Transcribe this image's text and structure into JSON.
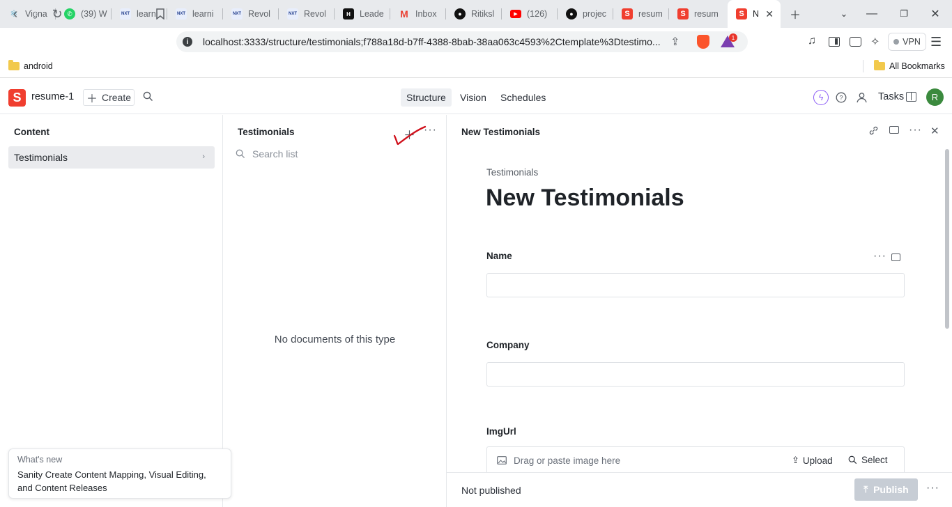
{
  "browser": {
    "tabs": [
      {
        "label": "Vigna",
        "icon": "react-icon",
        "color": "#61dafb"
      },
      {
        "label": "(39) W",
        "icon": "whatsapp-icon",
        "color": "#25d366"
      },
      {
        "label": "learni",
        "icon": "nxtwave-icon",
        "color": "#1e3a8a"
      },
      {
        "label": "learni",
        "icon": "nxtwave-icon",
        "color": "#1e3a8a"
      },
      {
        "label": "Revol",
        "icon": "nxtwave-icon",
        "color": "#1e3a8a"
      },
      {
        "label": "Revol",
        "icon": "nxtwave-icon",
        "color": "#1e3a8a"
      },
      {
        "label": "Leade",
        "icon": "hackerrank-icon",
        "color": "#111111"
      },
      {
        "label": "Inbox",
        "icon": "gmail-icon",
        "color": "#ea4335"
      },
      {
        "label": "Ritiksl",
        "icon": "github-icon",
        "color": "#111111"
      },
      {
        "label": "(126)",
        "icon": "youtube-icon",
        "color": "#ff0000"
      },
      {
        "label": "projec",
        "icon": "github-icon",
        "color": "#111111"
      },
      {
        "label": "resum",
        "icon": "sanity-icon",
        "color": "#f03e2f"
      },
      {
        "label": "resum",
        "icon": "sanity-icon",
        "color": "#f03e2f"
      },
      {
        "label": "N",
        "icon": "sanity-icon",
        "color": "#f03e2f"
      }
    ],
    "url": "localhost:3333/structure/testimonials;f788a18d-b7ff-4388-8bab-38aa063c4593%2Ctemplate%3Dtestimo...",
    "vpn_label": "VPN",
    "brave_badge": "1",
    "bookmarks": {
      "left": "android",
      "right": "All Bookmarks"
    }
  },
  "studio": {
    "logo_letter": "S",
    "workspace": "resume-1",
    "create_label": "Create",
    "nav_tabs": [
      "Structure",
      "Vision",
      "Schedules"
    ],
    "tasks_label": "Tasks",
    "avatar_letter": "R",
    "accent": "#f03e2f"
  },
  "pane_content": {
    "title": "Content",
    "items": [
      {
        "label": "Testimonials"
      }
    ]
  },
  "pane_list": {
    "title": "Testimonials",
    "search_placeholder": "Search list",
    "empty_text": "No documents of this type"
  },
  "pane_doc": {
    "header_title": "New Testimonials",
    "type_label": "Testimonials",
    "doc_title": "New Testimonials",
    "fields": {
      "name_label": "Name",
      "company_label": "Company",
      "imgurl_label": "ImgUrl",
      "image_drop_text": "Drag or paste image here",
      "upload_label": "Upload",
      "select_label": "Select"
    },
    "status": "Not published",
    "publish_label": "Publish"
  },
  "whats_new": {
    "title": "What's new",
    "body": "Sanity Create Content Mapping, Visual Editing, and Content Releases"
  }
}
